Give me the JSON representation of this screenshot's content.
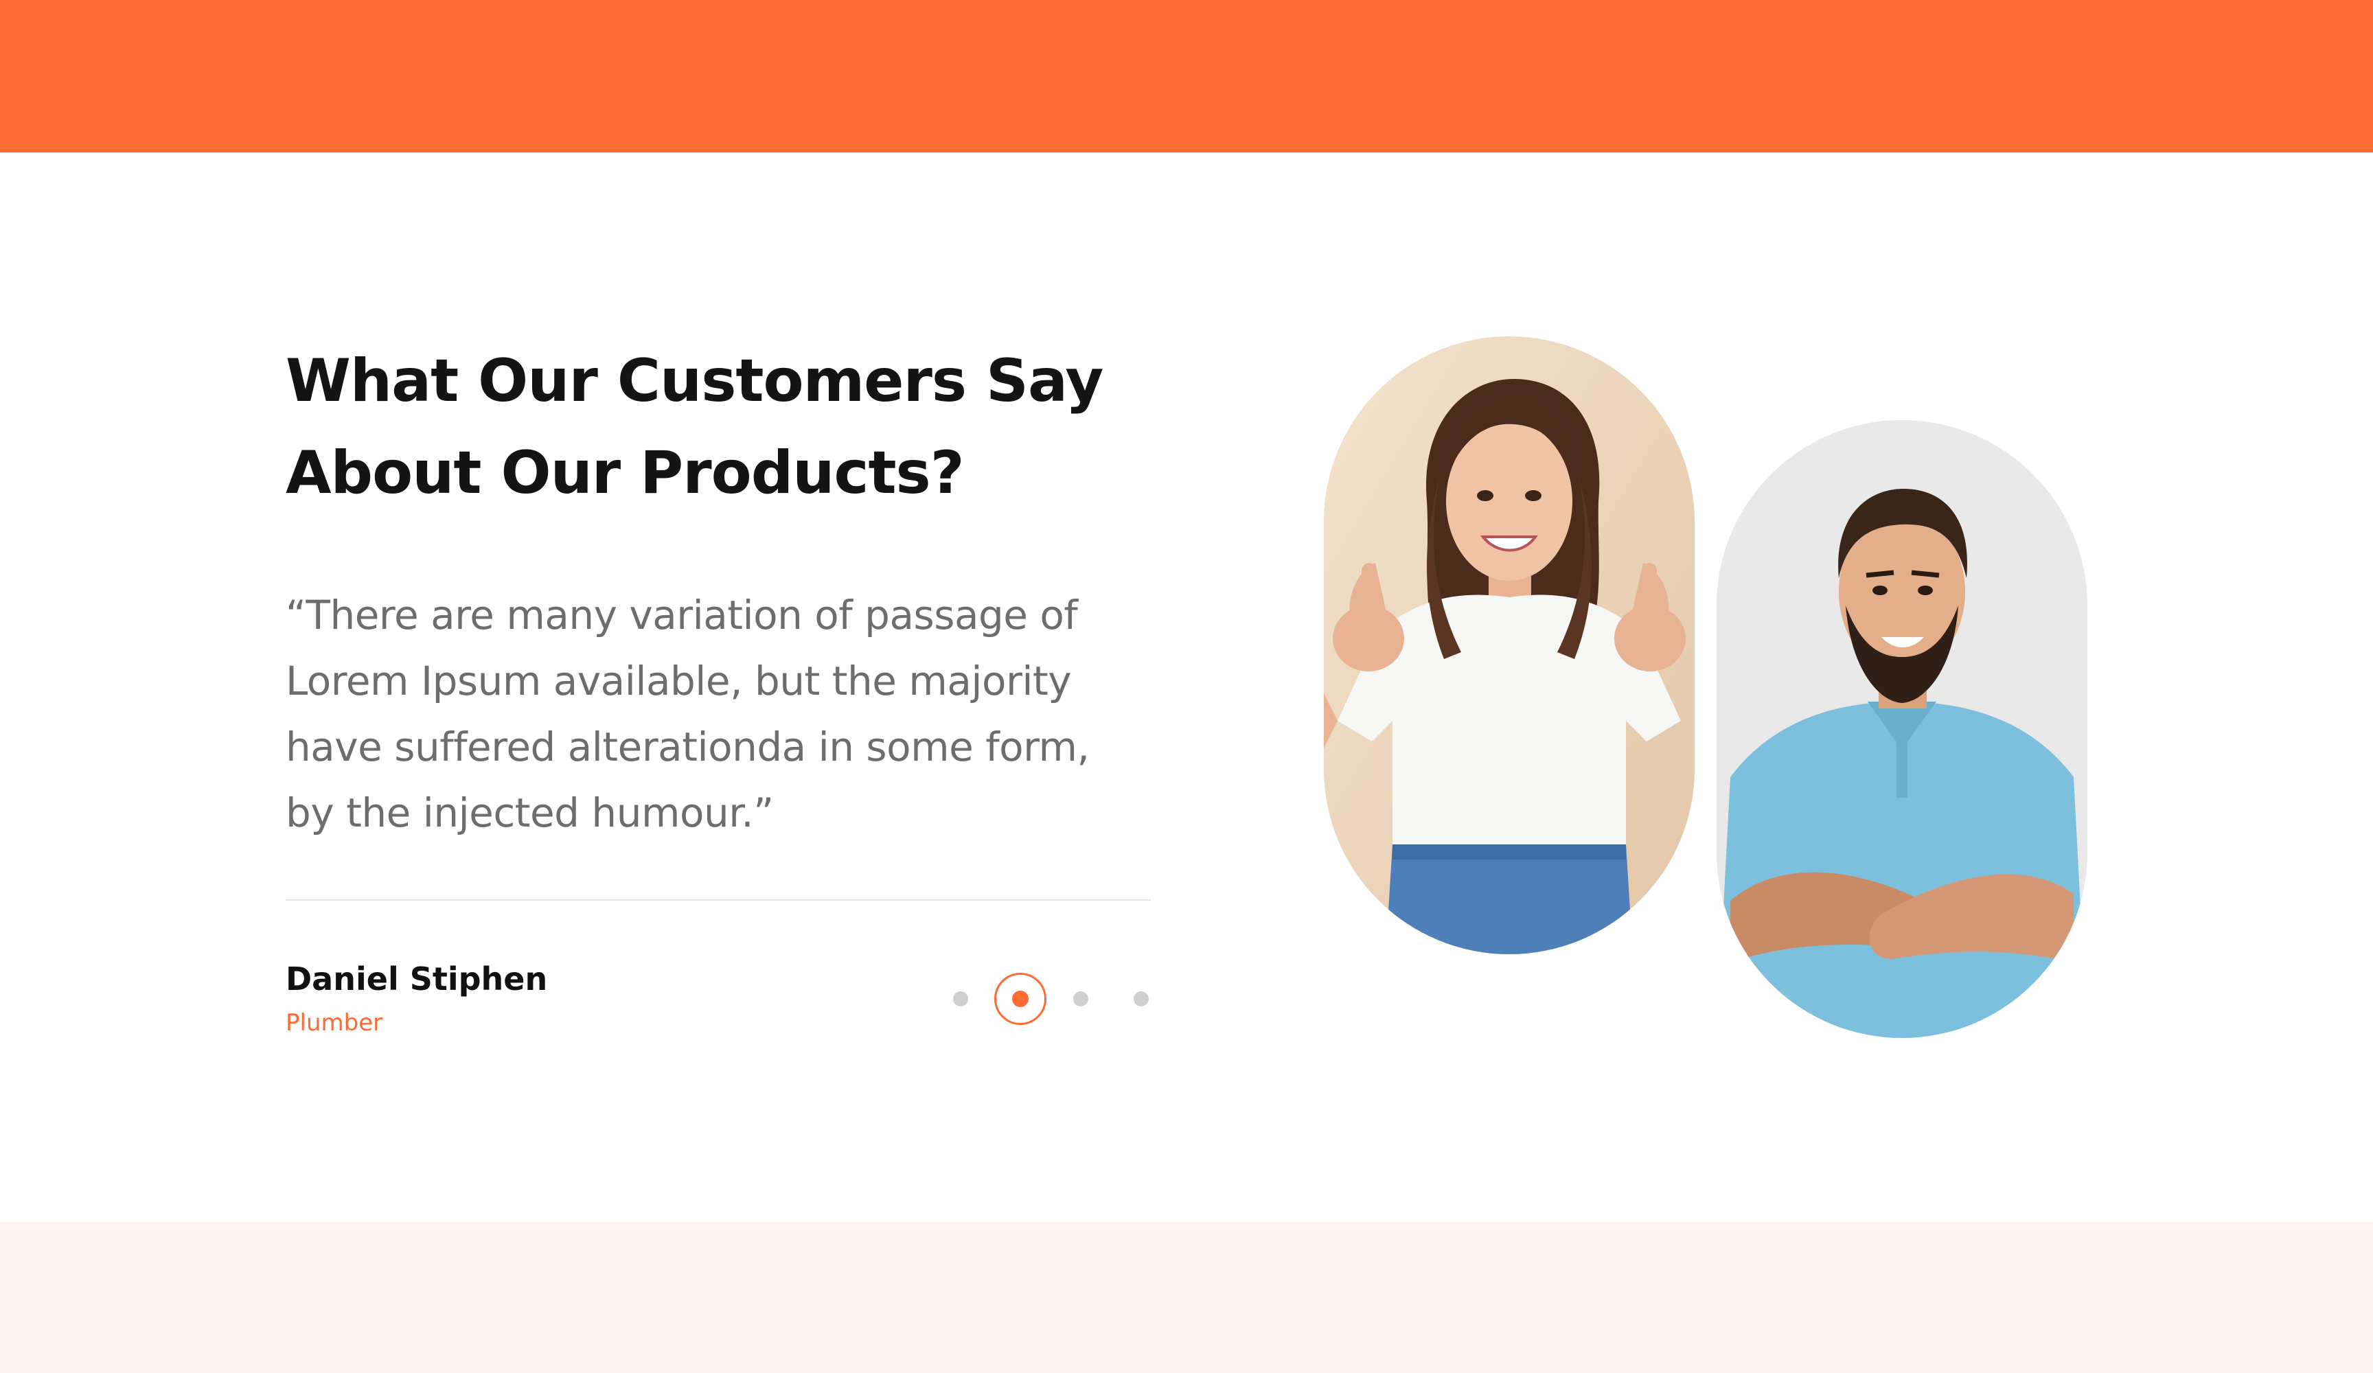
{
  "colors": {
    "accent": "#ff6b35",
    "heading": "#141414",
    "body_text": "#6d6d6d",
    "top_bar": "#ff6b35",
    "bottom_band": "#fff4f1",
    "dot_inactive": "#cfcfcf"
  },
  "testimonials": {
    "heading_line1": "What Our Customers Say",
    "heading_line2": "About Our Products?",
    "quote_line1": "“There are many variation of passage of",
    "quote_line2": "Lorem Ipsum available, but the majority",
    "quote_line3": "have suffered alterationda in some form,",
    "quote_line4": "by the injected humour.”",
    "author_name": "Daniel Stiphen",
    "author_role": "Plumber",
    "pagination": {
      "total": 4,
      "active_index": 2
    }
  },
  "images": {
    "customer_one": "smiling-woman-thumbs-up-photo",
    "customer_two": "smiling-bearded-man-arms-crossed-photo"
  }
}
